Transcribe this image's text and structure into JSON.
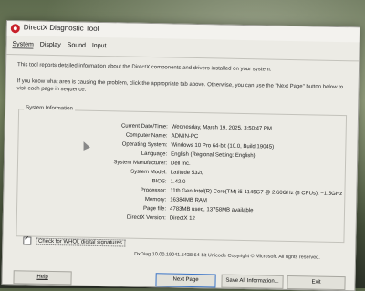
{
  "window": {
    "title": "DirectX Diagnostic Tool"
  },
  "tabs": [
    "System",
    "Display",
    "Sound",
    "Input"
  ],
  "intro": "This tool reports detailed information about the DirectX components and drivers installed on your system.",
  "instructions": "If you know what area is causing the problem, click the appropriate tab above.  Otherwise, you can use the \"Next Page\" button below to visit each page in sequence.",
  "system_info": {
    "title": "System Information",
    "rows": [
      {
        "label": "Current Date/Time:",
        "value": "Wednesday, March 19, 2025, 3:50:47 PM"
      },
      {
        "label": "Computer Name:",
        "value": "ADMIN-PC"
      },
      {
        "label": "Operating System:",
        "value": "Windows 10 Pro 64-bit (10.0, Build 19045)"
      },
      {
        "label": "Language:",
        "value": "English (Regional Setting: English)"
      },
      {
        "label": "System Manufacturer:",
        "value": "Dell Inc."
      },
      {
        "label": "System Model:",
        "value": "Latitude 5320"
      },
      {
        "label": "BIOS:",
        "value": "1.42.0"
      },
      {
        "label": "Processor:",
        "value": "11th Gen Intel(R) Core(TM) i5-1145G7 @ 2.60GHz (8 CPUs), ~1.5GHz"
      },
      {
        "label": "Memory:",
        "value": "16384MB RAM"
      },
      {
        "label": "Page file:",
        "value": "4783MB used, 13758MB available"
      },
      {
        "label": "DirectX Version:",
        "value": "DirectX 12"
      }
    ]
  },
  "whql": {
    "label": "Check for WHQL digital signatures",
    "checked": true
  },
  "footer": "DxDiag 10.00.19041.5438 64-bit Unicode  Copyright © Microsoft. All rights reserved.",
  "buttons": {
    "help": "Help",
    "next": "Next Page",
    "save": "Save All Information...",
    "exit": "Exit"
  }
}
